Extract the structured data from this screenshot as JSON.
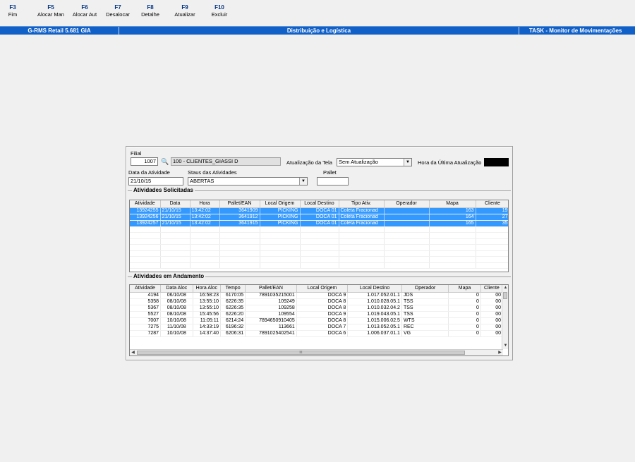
{
  "toolbar": {
    "keys": [
      {
        "key": "F3",
        "label": "Fim"
      },
      {
        "key": "F5",
        "label": "Alocar Man"
      },
      {
        "key": "F6",
        "label": "Alocar Aut"
      },
      {
        "key": "F7",
        "label": "Desalocar"
      },
      {
        "key": "F8",
        "label": "Detalhe"
      },
      {
        "key": "F9",
        "label": "Atualizar"
      },
      {
        "key": "F10",
        "label": "Excluir"
      }
    ]
  },
  "header": {
    "app": "G-RMS Retail 5.681 GIA",
    "module": "Distribuição e Logística",
    "task": "TASK - Monitor de Movimentações"
  },
  "form": {
    "filial_label": "Filial",
    "filial_code": "1007",
    "filial_name": "100 - CLIENTES_GIASSI D",
    "atualizacao_label": "Atualização da Tela",
    "atualizacao_value": "Sem Atualização",
    "hora_label": "Hora da Última Atualização",
    "data_label": "Data da Atividade",
    "data_value": "21/10/15",
    "status_label": "Staus das Atividades",
    "status_value": "ABERTAS",
    "pallet_label": "Pallet",
    "pallet_value": ""
  },
  "solicitadas": {
    "title": "Atividades Solicitadas",
    "columns": [
      "Atividade",
      "Data",
      "Hora",
      "Pallet/EAN",
      "Local Origem",
      "Local Destino",
      "Tipo Ativ.",
      "Operador",
      "Mapa",
      "Cliente"
    ],
    "rows": [
      [
        "13924255",
        "21/10/15",
        "13:42:02",
        "3641909",
        "PICKING",
        "DOCA  01",
        "Coleta Fracionad",
        "",
        "163",
        "19"
      ],
      [
        "13924256",
        "21/10/15",
        "13:42:02",
        "3641912",
        "PICKING",
        "DOCA  01",
        "Coleta Fracionad",
        "",
        "164",
        "27"
      ],
      [
        "13924257",
        "21/10/15",
        "13:42:02",
        "3641915",
        "PICKING",
        "DOCA  01",
        "Coleta Fracionad",
        "",
        "165",
        "35"
      ]
    ]
  },
  "andamento": {
    "title": "Atividades em Andamento",
    "columns": [
      "Atividade",
      "Data Aloc",
      "Hora Aloc",
      "Tempo",
      "Pallet/EAN",
      "Local Origem",
      "Local Destino",
      "Operador",
      "Mapa",
      "Cliente"
    ],
    "rows": [
      [
        "4194",
        "06/10/08",
        "16:58:23",
        "6170:05",
        "7891035215001",
        "DOCA  9",
        "1.017.052.01.1",
        "JDS",
        "0",
        "00"
      ],
      [
        "5358",
        "08/10/08",
        "13:55:10",
        "6226:35",
        "109249",
        "DOCA  8",
        "1.010.028.05.1",
        "TSS",
        "0",
        "00"
      ],
      [
        "5367",
        "08/10/08",
        "13:55:10",
        "6226:35",
        "109258",
        "DOCA  8",
        "1.010.032.04.2",
        "TSS",
        "0",
        "00"
      ],
      [
        "5527",
        "08/10/08",
        "15:45:56",
        "6226:20",
        "109554",
        "DOCA  9",
        "1.019.043.05.1",
        "TSS",
        "0",
        "00"
      ],
      [
        "7007",
        "10/10/08",
        "11:05:11",
        "6214:24",
        "7894650910405",
        "DOCA  8",
        "1.015.006.02.5",
        "WTS",
        "0",
        "00"
      ],
      [
        "7275",
        "11/10/08",
        "14:33:19",
        "6196:32",
        "113661",
        "DOCA  7",
        "1.013.052.05.1",
        "REC",
        "0",
        "00"
      ],
      [
        "7287",
        "10/10/08",
        "14:37:40",
        "6206:31",
        "7891025402541",
        "DOCA  6",
        "1.006.037.01.1",
        "VG",
        "0",
        "00"
      ]
    ],
    "hscroll_glyph": "III"
  }
}
